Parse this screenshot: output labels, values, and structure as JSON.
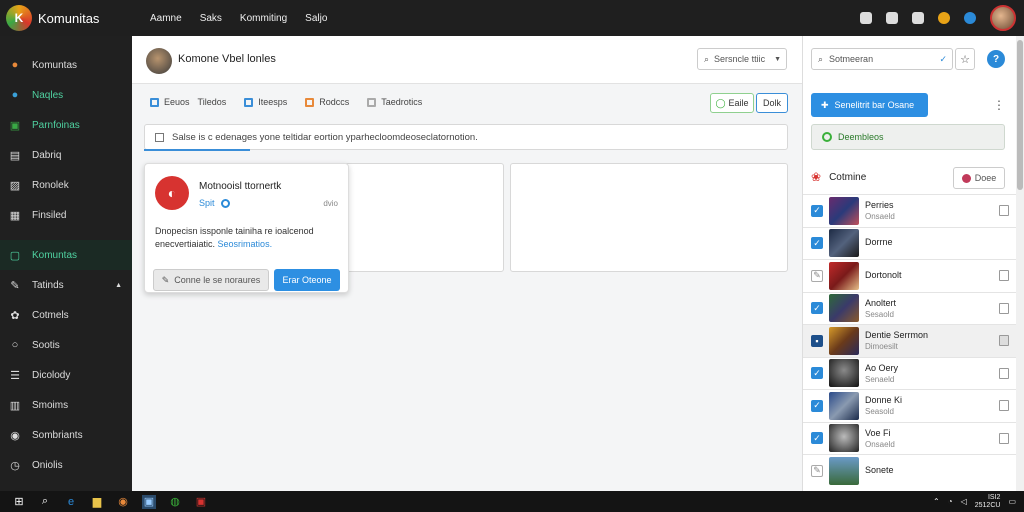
{
  "app": {
    "name": "Komunitas"
  },
  "topnav": [
    "Aamne",
    "Saks",
    "Kommiting",
    "Saljo"
  ],
  "sidebar": {
    "items": [
      {
        "label": "Komuntas",
        "icon": "community-icon"
      },
      {
        "label": "Naqles",
        "icon": "globe-icon"
      },
      {
        "label": "Parnfoinas",
        "icon": "chart-icon"
      },
      {
        "label": "Dabriq",
        "icon": "grid-icon"
      },
      {
        "label": "Ronolek",
        "icon": "image-icon"
      },
      {
        "label": "Finsiled",
        "icon": "folder-icon"
      },
      {
        "label": "Komuntas",
        "icon": "chat-icon"
      },
      {
        "label": "Tatinds",
        "icon": "tag-icon"
      },
      {
        "label": "Cotmels",
        "icon": "settings-icon"
      },
      {
        "label": "Sootis",
        "icon": "circle-icon"
      },
      {
        "label": "Dicolody",
        "icon": "list-icon"
      },
      {
        "label": "Smoims",
        "icon": "layers-icon"
      },
      {
        "label": "Sombriants",
        "icon": "user-icon"
      },
      {
        "label": "Oniolis",
        "icon": "clock-icon"
      }
    ]
  },
  "profile": {
    "name": "Komone Vbel lonles"
  },
  "search_top": {
    "placeholder": "Sersncle ttiic"
  },
  "tabs": [
    {
      "label": "Eeuos",
      "color": "blue"
    },
    {
      "label": "Tiledos",
      "color": "none"
    },
    {
      "label": "Iteesps",
      "color": "blue"
    },
    {
      "label": "Rodccs",
      "color": "orange"
    },
    {
      "label": "Taedrotics",
      "color": "grey"
    }
  ],
  "actions": {
    "edit": "Eaile",
    "edit2": "Dolk"
  },
  "notice": {
    "text": "Salse is c edenages yone teltidar eortion yparhecloomdeoseclatornotion."
  },
  "card": {
    "title": "Motnooisl ttornertk",
    "sub": "Spit",
    "time": "dvio",
    "text": "Dnopecisn issponle tainiha re ioalcenod enecvertiaiatic.",
    "link": "Seosrimatios.",
    "btn_secondary": "Conne le se noraures",
    "btn_primary": "Erar Oteone"
  },
  "right": {
    "search": {
      "placeholder": "Sotmeeran"
    },
    "btn_primary": "Senelitrit bar Osane",
    "btn_green": "Deembleos",
    "list_title": "Cotmine",
    "btn_done": "Doee",
    "items": [
      {
        "name": "Perries",
        "sub": "Onsaeld",
        "checked": true,
        "shaded": false
      },
      {
        "name": "Dorrne",
        "sub": "",
        "checked": true,
        "shaded": false
      },
      {
        "name": "Dortonolt",
        "sub": "",
        "checked": false,
        "shaded": false
      },
      {
        "name": "Anoltert",
        "sub": "Sesaold",
        "checked": true,
        "shaded": false
      },
      {
        "name": "Dentie Serrmon",
        "sub": "Dimoesilt",
        "checked": true,
        "shaded": true
      },
      {
        "name": "Ao Oery",
        "sub": "Senaeld",
        "checked": true,
        "shaded": false
      },
      {
        "name": "Donne Ki",
        "sub": "Seasold",
        "checked": true,
        "shaded": false
      },
      {
        "name": "Voe Fi",
        "sub": "Onsaeld",
        "checked": true,
        "shaded": false
      },
      {
        "name": "Sonete",
        "sub": "",
        "checked": false,
        "shaded": false
      }
    ]
  },
  "taskbar": {
    "clock_time": "ISI2",
    "clock_date": "2512CU"
  }
}
